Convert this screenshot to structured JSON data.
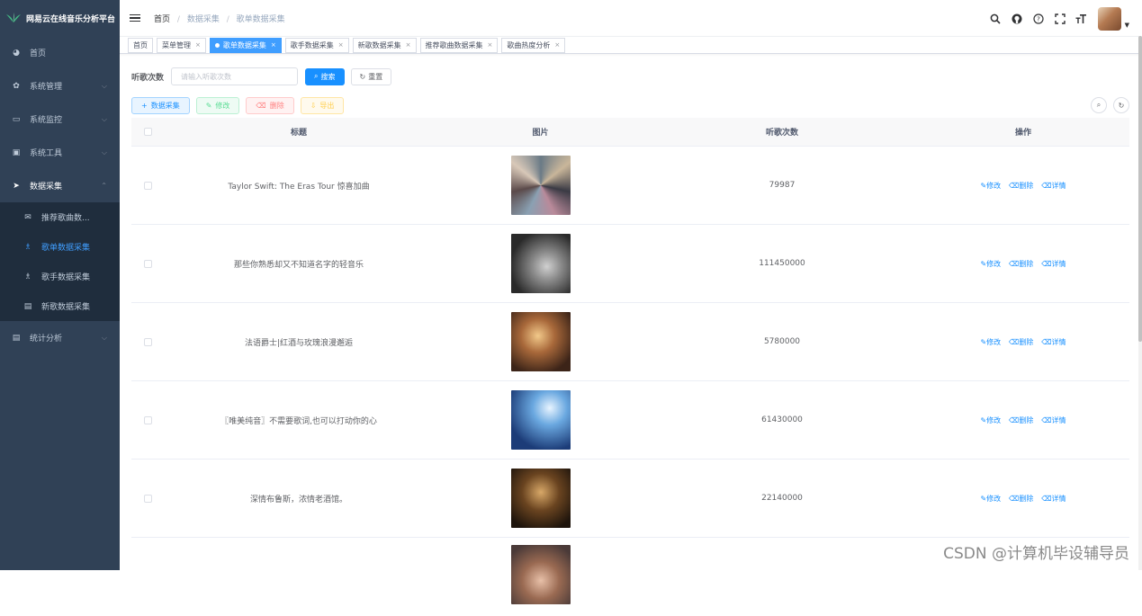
{
  "sidebar": {
    "app_title": "网易云在线音乐分析平台",
    "menu": [
      {
        "label": "首页",
        "icon": "dashboard-icon",
        "glyph": "◕"
      },
      {
        "label": "系统管理",
        "icon": "gear-icon",
        "glyph": "✿"
      },
      {
        "label": "系统监控",
        "icon": "monitor-icon",
        "glyph": "▭"
      },
      {
        "label": "系统工具",
        "icon": "toolbox-icon",
        "glyph": "▣"
      },
      {
        "label": "数据采集",
        "icon": "send-icon",
        "glyph": "➤"
      },
      {
        "label": "统计分析",
        "icon": "chart-icon",
        "glyph": "▤"
      }
    ],
    "submenu": [
      {
        "label": "推荐歌曲数...",
        "icon": "mail-icon",
        "glyph": "✉"
      },
      {
        "label": "歌单数据采集",
        "icon": "user-icon",
        "glyph": "♗"
      },
      {
        "label": "歌手数据采集",
        "icon": "user-icon",
        "glyph": "♗"
      },
      {
        "label": "新歌数据采集",
        "icon": "list-icon",
        "glyph": "▤"
      }
    ]
  },
  "breadcrumb": {
    "home": "首页",
    "level1": "数据采集",
    "level2": "歌单数据采集"
  },
  "tags": [
    "首页",
    "菜单管理",
    "歌单数据采集",
    "歌手数据采集",
    "新歌数据采集",
    "推荐歌曲数据采集",
    "歌曲热度分析"
  ],
  "search": {
    "label": "听歌次数",
    "placeholder": "请输入听歌次数",
    "search_btn": "搜索",
    "reset_btn": "重置"
  },
  "toolbar": {
    "add": "数据采集",
    "edit": "修改",
    "delete": "删除",
    "export": "导出"
  },
  "table": {
    "headers": {
      "title": "标题",
      "image": "图片",
      "count": "听歌次数",
      "ops": "操作"
    },
    "ops": {
      "edit": "修改",
      "delete": "删除",
      "detail": "详情"
    },
    "rows": [
      {
        "title": "Taylor Swift: The Eras Tour 惊喜加曲",
        "count": "79987"
      },
      {
        "title": "那些你熟悉却又不知道名字的轻音乐",
        "count": "111450000"
      },
      {
        "title": "法语爵士|红酒与玫瑰浪漫邂逅",
        "count": "5780000"
      },
      {
        "title": "〖唯美纯音〗不需要歌词,也可以打动你的心",
        "count": "61430000"
      },
      {
        "title": "深情布鲁斯，浓情老酒馆。",
        "count": "22140000"
      }
    ]
  },
  "watermark": "CSDN @计算机毕设辅导员",
  "colors": {
    "sidebar_bg": "#304156",
    "submenu_bg": "#1f2d3d",
    "primary": "#1890ff",
    "active_menu": "#409eff"
  }
}
